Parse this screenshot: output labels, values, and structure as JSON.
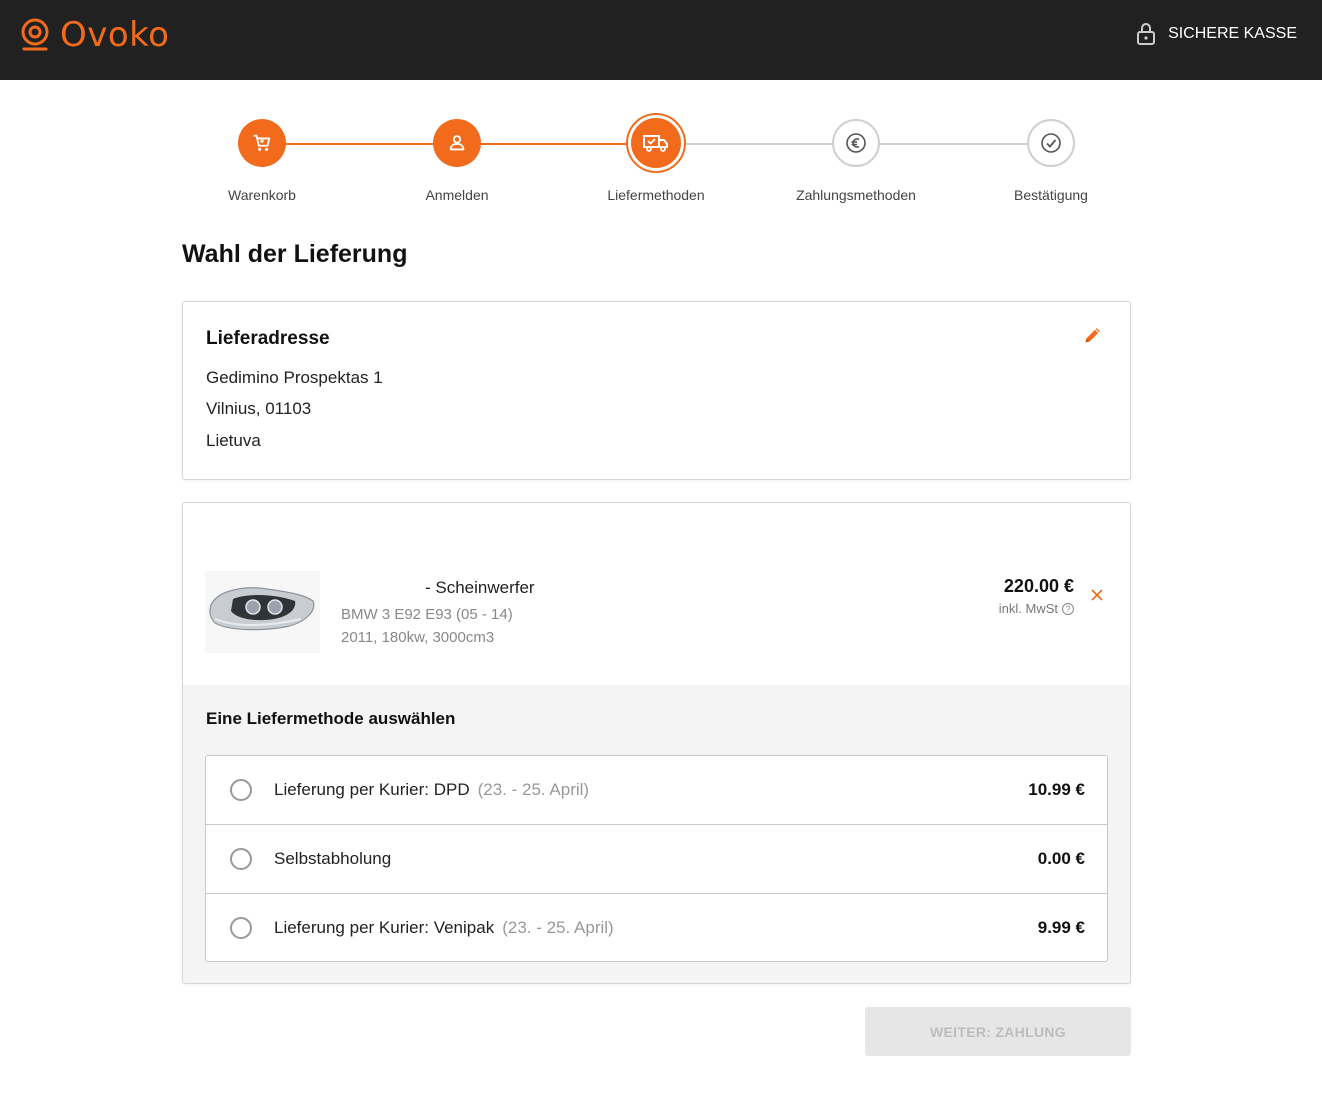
{
  "header": {
    "brand": "Ovoko",
    "secure_label": "SICHERE KASSE",
    "accent_color": "#f26b1d",
    "background": "#212121"
  },
  "stepper": {
    "steps": [
      {
        "label": "Warenkorb",
        "state": "done",
        "icon": "cart-icon"
      },
      {
        "label": "Anmelden",
        "state": "done",
        "icon": "user-icon"
      },
      {
        "label": "Liefermethoden",
        "state": "active",
        "icon": "truck-icon"
      },
      {
        "label": "Zahlungsmethoden",
        "state": "todo",
        "icon": "euro-icon"
      },
      {
        "label": "Bestätigung",
        "state": "todo",
        "icon": "check-icon"
      }
    ]
  },
  "page": {
    "title": "Wahl der Lieferung"
  },
  "address": {
    "title": "Lieferadresse",
    "line1": "Gedimino Prospektas 1",
    "line2": "Vilnius, 01103",
    "line3": "Lietuva"
  },
  "item": {
    "title": "- Scheinwerfer",
    "car": "BMW 3 E92 E93 (05 - 14)",
    "specs": "2011, 180kw, 3000cm3",
    "price": "220.00 €",
    "vat": "inkl. MwSt"
  },
  "shipping": {
    "title": "Eine Liefermethode auswählen",
    "options": [
      {
        "label": "Lieferung per Kurier: DPD",
        "date": "(23. - 25. April)",
        "price": "10.99 €"
      },
      {
        "label": "Selbstabholung",
        "date": "",
        "price": "0.00 €"
      },
      {
        "label": "Lieferung per Kurier: Venipak",
        "date": "(23. - 25. April)",
        "price": "9.99 €"
      }
    ]
  },
  "actions": {
    "continue_label": "WEITER: ZAHLUNG"
  }
}
